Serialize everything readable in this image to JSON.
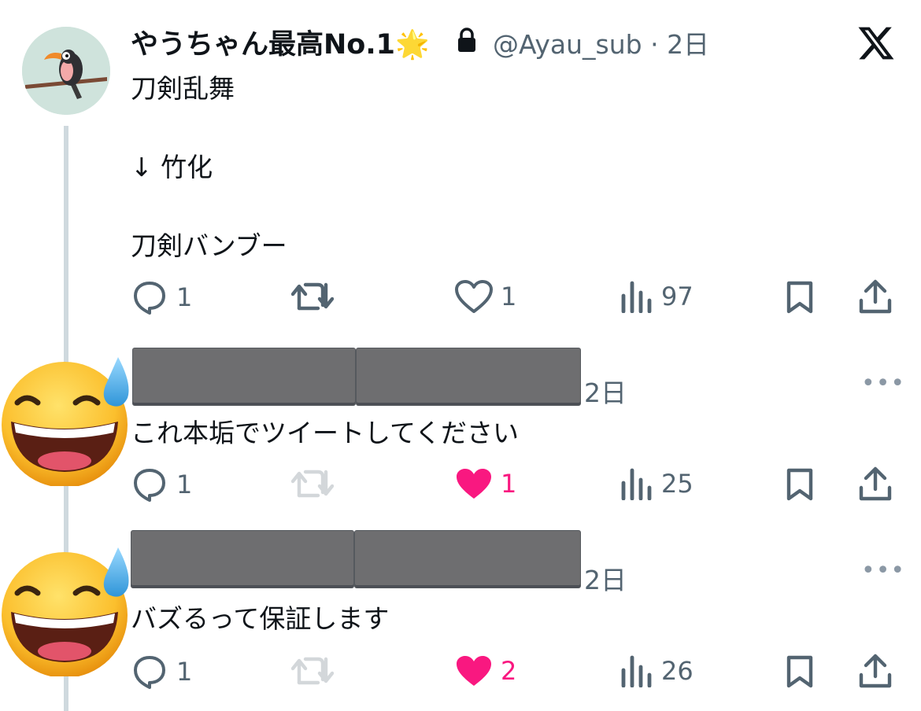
{
  "post": {
    "display_name": "やうちゃん最高No.1",
    "name_emoji": "🌟",
    "handle": "@Ayau_sub",
    "separator": "·",
    "time": "2日",
    "text_line1": "刀剣乱舞",
    "text_line2": "↓ 竹化",
    "text_line3": "刀剣バンブー",
    "actions": {
      "replies": "1",
      "reposts": "",
      "likes": "1",
      "views": "97"
    }
  },
  "replies": [
    {
      "time": "2日",
      "text": "これ本垢でツイートしてください",
      "actions": {
        "replies": "1",
        "reposts": "",
        "likes": "1",
        "views": "25"
      }
    },
    {
      "time": "2日",
      "text": "バズるって保証します",
      "actions": {
        "replies": "1",
        "reposts": "",
        "likes": "2",
        "views": "26"
      }
    }
  ],
  "icons": {
    "logo": "x-logo-icon",
    "lock": "lock-icon",
    "reply": "reply-icon",
    "repost": "repost-icon",
    "like": "heart-icon",
    "views": "views-icon",
    "bookmark": "bookmark-icon",
    "share": "share-icon",
    "more": "more-icon"
  },
  "colors": {
    "text": "#0f1419",
    "muted": "#536471",
    "like": "#f91880",
    "thread": "#cfd9de"
  }
}
